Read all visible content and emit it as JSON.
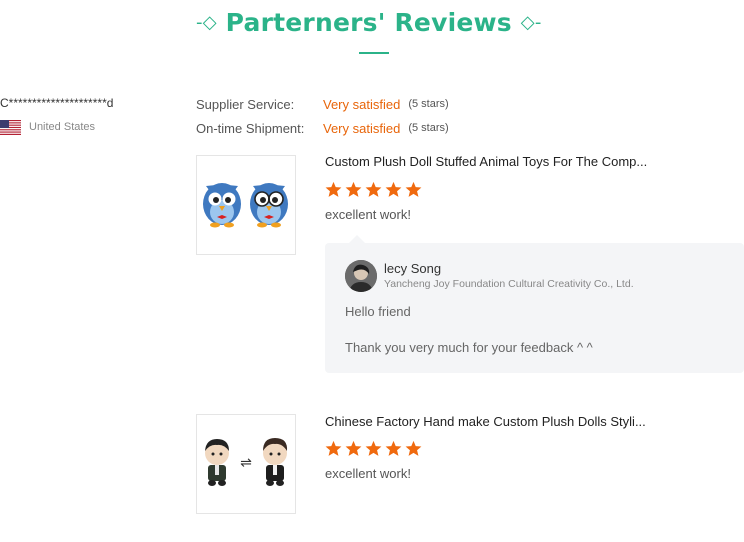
{
  "header": {
    "title": "Parterners' Reviews",
    "left_ornament": "-◇",
    "right_ornament": "◇-",
    "accent_color": "#2bb389"
  },
  "reviewer": {
    "name": "C*********************d",
    "country": "United States",
    "flag_icon": "us-flag-icon"
  },
  "ratings": [
    {
      "label": "Supplier Service:",
      "value": "Very satisfied",
      "count": "(5 stars)"
    },
    {
      "label": "On-time Shipment:",
      "value": "Very satisfied",
      "count": "(5 stars)"
    }
  ],
  "reviews": [
    {
      "product_title": "Custom Plush Doll Stuffed Animal Toys For The Comp...",
      "stars": 5,
      "text": "excellent work!",
      "image_icon": "owl-plush-image",
      "reply": {
        "name": "lecy Song",
        "company": "Yancheng Joy Foundation Cultural Creativity Co., Ltd.",
        "lines": [
          "Hello friend",
          "Thank you very much for your feedback ^ ^"
        ]
      }
    },
    {
      "product_title": "Chinese Factory Hand make Custom Plush Dolls Styli...",
      "stars": 5,
      "text": "excellent work!",
      "image_icon": "doll-plush-image"
    }
  ],
  "colors": {
    "star": "#f06a0f",
    "rating_value": "#e8650a"
  }
}
